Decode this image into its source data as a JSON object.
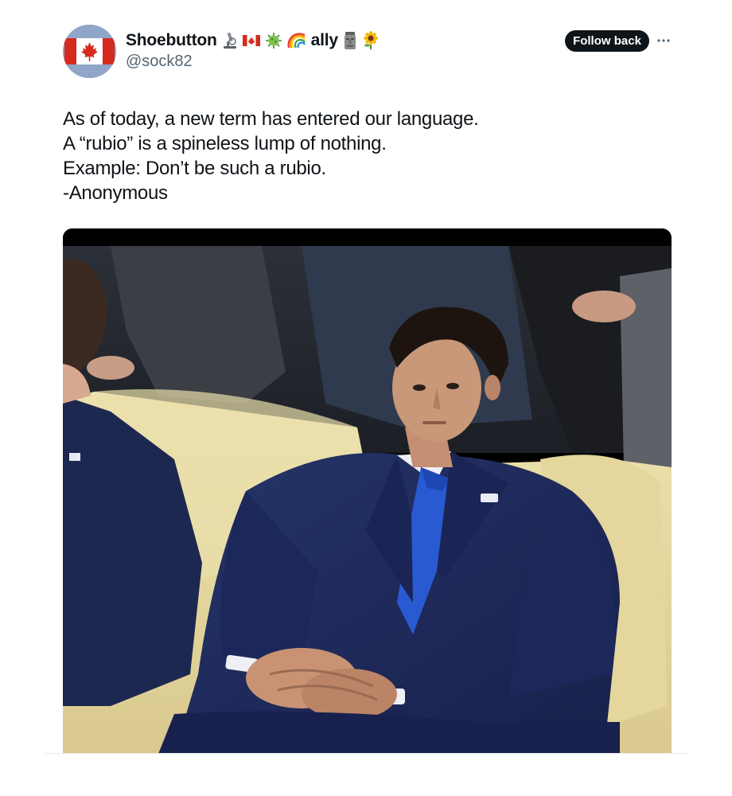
{
  "post": {
    "author": {
      "display_name": "Shoebutton",
      "name_emojis": [
        {
          "icon": "microscope-emoji"
        },
        {
          "icon": "canada-flag-emoji"
        },
        {
          "icon": "virus-emoji"
        },
        {
          "icon": "rainbow-emoji"
        }
      ],
      "name_suffix": "ally",
      "name_trailing_emojis": [
        {
          "icon": "moai-emoji"
        },
        {
          "icon": "sunflower-emoji"
        }
      ],
      "handle": "@sock82",
      "avatar_icon": "canada-flag-avatar"
    },
    "follow_button_label": "Follow back",
    "more_icon": "more-options-icon",
    "text_lines": [
      "As of today, a new term has entered our language.",
      "A “rubio” is a spineless lump of nothing.",
      "Example: Don’t be such a rubio.",
      "-Anonymous"
    ],
    "media": {
      "kind": "photo",
      "subject": "man in navy suit and blue tie seated on a cream sofa"
    }
  },
  "colors": {
    "text": "#0f1419",
    "secondary_text": "#536471",
    "button_bg": "#0f1419",
    "button_text": "#ffffff",
    "flag_red": "#d52b1e",
    "suit_navy": "#1f2b58",
    "tie_blue": "#2a5ad1",
    "sofa_cream": "#e9dca6"
  }
}
